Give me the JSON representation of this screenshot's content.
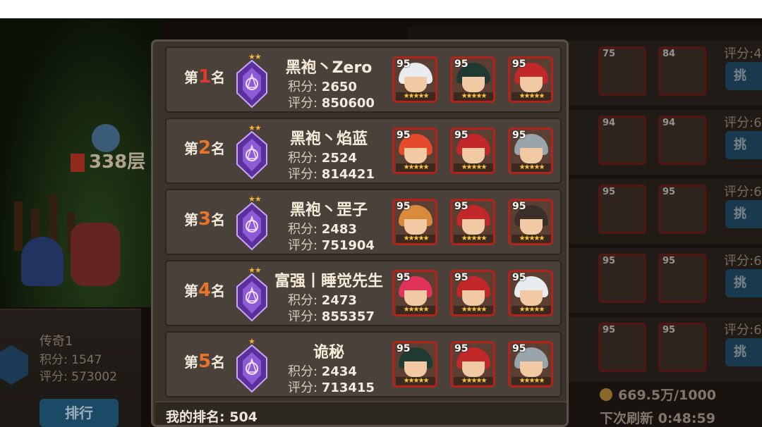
{
  "background": {
    "floor_label": "338层",
    "my_card": {
      "name": "传奇1",
      "score_line": "积分: 1547",
      "rating_line": "评分: 573002",
      "rank_button": "排行"
    },
    "right_list": {
      "rows": [
        {
          "caption": "评分:4",
          "levels": [
            "75",
            "84"
          ]
        },
        {
          "caption": "评分:6",
          "levels": [
            "94",
            "94"
          ]
        },
        {
          "caption": "评分:6",
          "levels": [
            "95",
            "95"
          ]
        },
        {
          "caption": "评分:6",
          "levels": [
            "95",
            "95"
          ]
        },
        {
          "caption": "评分:6",
          "levels": [
            "95",
            "95"
          ]
        }
      ],
      "button_label": "挑",
      "currency": "669.5万/1000",
      "refresh": "下次刷新 0:48:59"
    }
  },
  "leaderboard": {
    "score_key": "积分:",
    "rating_key": "评分:",
    "rank_prefix": "第",
    "rank_suffix": "名",
    "entries": [
      {
        "rank": "1",
        "name": "黑袍丶Zero",
        "score": "2650",
        "rating": "850600",
        "badge_stars": "★★",
        "heroes": [
          {
            "level": "95",
            "hair": "#e9ecef"
          },
          {
            "level": "95",
            "hair": "#1f3a33"
          },
          {
            "level": "95",
            "hair": "#c2282a"
          }
        ]
      },
      {
        "rank": "2",
        "name": "黑袍丶焰蓝",
        "score": "2524",
        "rating": "814421",
        "badge_stars": "★★",
        "heroes": [
          {
            "level": "95",
            "hair": "#e34b2c"
          },
          {
            "level": "95",
            "hair": "#c2282a"
          },
          {
            "level": "95",
            "hair": "#9aa4ad"
          }
        ]
      },
      {
        "rank": "3",
        "name": "黑袍丶罡子",
        "score": "2483",
        "rating": "751904",
        "badge_stars": "★★",
        "heroes": [
          {
            "level": "95",
            "hair": "#d98a3a"
          },
          {
            "level": "95",
            "hair": "#c2282a"
          },
          {
            "level": "95",
            "hair": "#3a2f2a"
          }
        ]
      },
      {
        "rank": "4",
        "name": "富强丨睡觉先生",
        "score": "2473",
        "rating": "855357",
        "badge_stars": "★★",
        "heroes": [
          {
            "level": "95",
            "hair": "#e0325a"
          },
          {
            "level": "95",
            "hair": "#c2282a"
          },
          {
            "level": "95",
            "hair": "#e9ecef"
          }
        ]
      },
      {
        "rank": "5",
        "name": "诡秘",
        "score": "2434",
        "rating": "713415",
        "badge_stars": "★",
        "heroes": [
          {
            "level": "95",
            "hair": "#1f3a33"
          },
          {
            "level": "95",
            "hair": "#c2282a"
          },
          {
            "level": "95",
            "hair": "#9aa4ad"
          }
        ]
      }
    ],
    "hero_stars": "★★★★★",
    "my_rank_label": "我的排名:",
    "my_rank_value": "504"
  },
  "colors": {
    "rank_top": "#e23a2a",
    "rank_other": "#e8742a",
    "portrait_border": "#b2231b",
    "badge_purple": "#8e5bd6"
  },
  "icons": {
    "rank_badge": "purple-crest-icon",
    "hero_portrait": "hero-portrait-icon",
    "coin": "gold-coin-icon"
  }
}
